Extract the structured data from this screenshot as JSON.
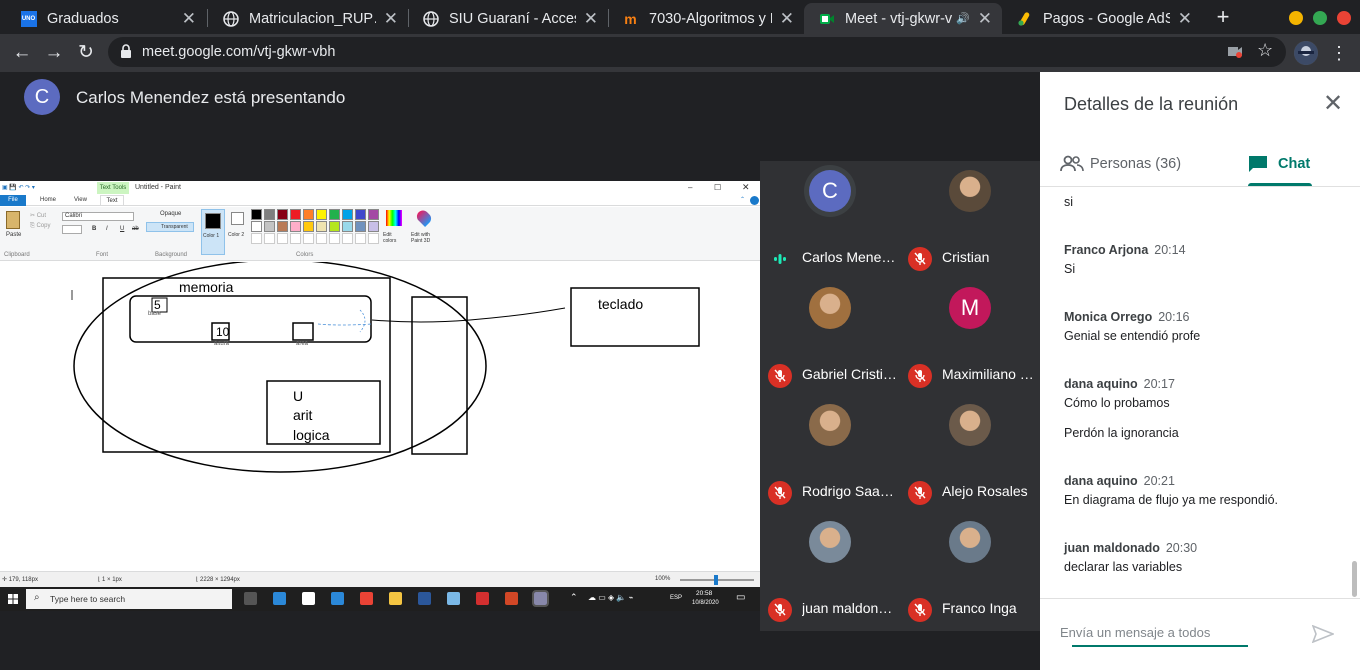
{
  "browser": {
    "tabs": [
      {
        "title": "Graduados",
        "icon": "uno-icon"
      },
      {
        "title": "Matriculacion_RUP…",
        "icon": "globe-icon"
      },
      {
        "title": "SIU Guaraní - Acceso",
        "icon": "globe-icon"
      },
      {
        "title": "7030-Algoritmos y E…",
        "icon": "moodle-icon"
      },
      {
        "title": "Meet - vtj-gkwr-v…",
        "icon": "meet-icon",
        "active": true
      },
      {
        "title": "Pagos - Google AdS…",
        "icon": "google-ads-icon"
      }
    ],
    "new_tab": "+",
    "url": "meet.google.com/vtj-gkwr-vbh"
  },
  "meet": {
    "presenter_initial": "C",
    "presenter_text": "Carlos Menendez está presentando",
    "participants": [
      {
        "name": "Carlos Menen…",
        "initial": "C",
        "color": "#5c6bc0",
        "speaking": true
      },
      {
        "name": "Cristian",
        "photo": true,
        "muted": true
      },
      {
        "name": "Gabriel Cristino",
        "photo": true,
        "muted": true
      },
      {
        "name": "Maximiliano …",
        "initial": "M",
        "color": "#c2185b",
        "muted": true
      },
      {
        "name": "Rodrigo Saav…",
        "photo": true,
        "muted": true
      },
      {
        "name": "Alejo Rosales",
        "photo": true,
        "muted": true
      },
      {
        "name": "juan maldona…",
        "photo": true,
        "muted": true
      },
      {
        "name": "Franco Inga",
        "photo": true,
        "muted": true
      }
    ]
  },
  "paint": {
    "title": "Untitled - Paint",
    "tool_tab": "Text Tools",
    "menu": [
      "File",
      "Home",
      "View",
      "Text"
    ],
    "font": "Calibri",
    "groups": [
      "Clipboard",
      "Font",
      "Background",
      "Colors"
    ],
    "labels": {
      "paste": "Paste",
      "cut": "Cut",
      "copy": "Copy",
      "opaque": "Opaque",
      "transparent": "Transparent",
      "color1": "Color 1",
      "color2": "Color 2",
      "edit_colors": "Edit colors",
      "edit_paint3d": "Edit with Paint 3D"
    },
    "canvas": {
      "memoria": "memoria",
      "five": "5",
      "base": "base",
      "ten": "10",
      "altura": "altura",
      "area": "area",
      "teclado": "teclado",
      "u": "U",
      "arit": "arit",
      "logica": "logica"
    },
    "status": {
      "pos": "179, 118px",
      "sel": "1 × 1px",
      "size": "2228 × 1294px",
      "zoom": "100%"
    },
    "palette": [
      "#000000",
      "#7f7f7f",
      "#880015",
      "#ed1c24",
      "#ff7f27",
      "#fff200",
      "#22b14c",
      "#00a2e8",
      "#3f48cc",
      "#a349a4",
      "#ffffff",
      "#c3c3c3",
      "#b97a57",
      "#ffaec9",
      "#ffc90e",
      "#efe4b0",
      "#b5e61d",
      "#99d9ea",
      "#7092be",
      "#c8bfe7"
    ]
  },
  "taskbar": {
    "search": "Type here to search",
    "lang": "ESP",
    "time": "20:58",
    "date": "10/8/2020"
  },
  "panel": {
    "title": "Detalles de la reunión",
    "tab_people": "Personas (36)",
    "tab_chat": "Chat",
    "messages": [
      {
        "author": "",
        "time": "",
        "text": "si"
      },
      {
        "author": "Franco Arjona",
        "time": "20:14",
        "text": "Si"
      },
      {
        "author": "Monica Orrego",
        "time": "20:16",
        "text": "Genial se entendió profe"
      },
      {
        "author": "dana aquino",
        "time": "20:17",
        "text": "Cómo lo probamos"
      },
      {
        "author": "",
        "time": "",
        "text": "Perdón la ignorancia"
      },
      {
        "author": "dana aquino",
        "time": "20:21",
        "text": "En diagrama de flujo ya me respondió."
      },
      {
        "author": "juan maldonado",
        "time": "20:30",
        "text": "declarar las variables"
      }
    ],
    "compose_placeholder": "Envía un mensaje a todos"
  }
}
